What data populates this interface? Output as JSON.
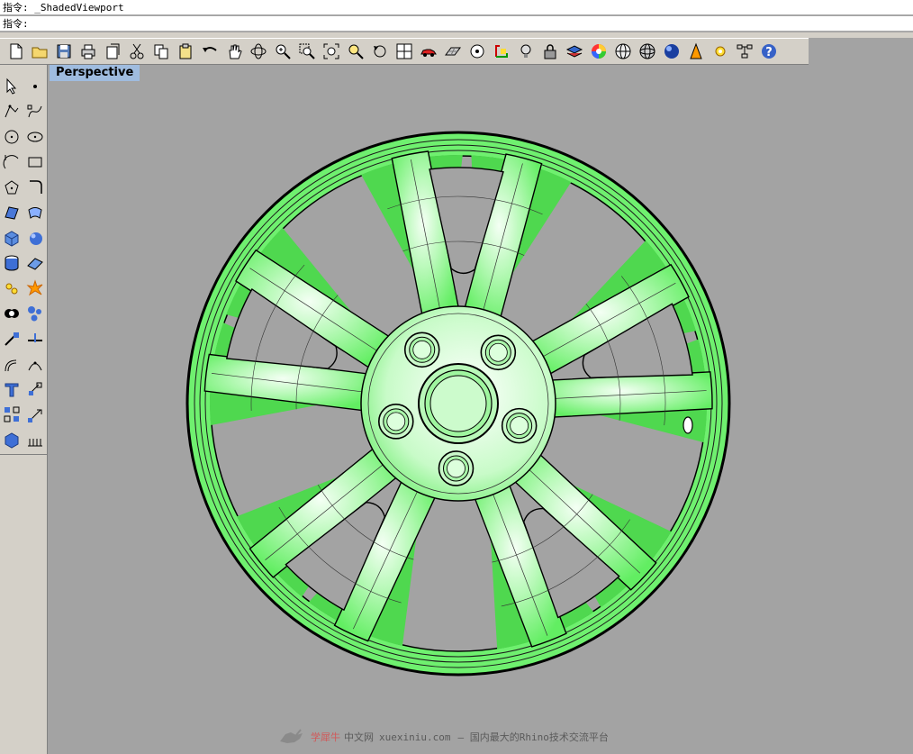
{
  "command": {
    "history_label": "指令:",
    "history_text": "_ShadedViewport",
    "prompt_label": "指令:",
    "input_value": ""
  },
  "toolbar_top": [
    {
      "icon": "new-file-icon"
    },
    {
      "icon": "open-folder-icon"
    },
    {
      "icon": "save-disk-icon"
    },
    {
      "icon": "print-icon"
    },
    {
      "icon": "import-icon"
    },
    {
      "icon": "cut-icon"
    },
    {
      "icon": "copy-icon"
    },
    {
      "icon": "paste-icon"
    },
    {
      "icon": "undo-icon"
    },
    {
      "icon": "pan-hand-icon"
    },
    {
      "icon": "rotate-view-icon"
    },
    {
      "icon": "zoom-dynamic-icon"
    },
    {
      "icon": "zoom-window-icon"
    },
    {
      "icon": "zoom-extents-icon"
    },
    {
      "icon": "zoom-selected-icon"
    },
    {
      "icon": "undo-view-icon"
    },
    {
      "icon": "four-viewports-icon"
    },
    {
      "icon": "car-icon"
    },
    {
      "icon": "grid-plane-icon"
    },
    {
      "icon": "osnap-icon"
    },
    {
      "icon": "gumball-icon"
    },
    {
      "icon": "light-bulb-icon"
    },
    {
      "icon": "lock-icon"
    },
    {
      "icon": "layer-icon"
    },
    {
      "icon": "color-wheel-icon"
    },
    {
      "icon": "wireframe-sphere-icon"
    },
    {
      "icon": "mesh-sphere-icon"
    },
    {
      "icon": "shaded-sphere-icon"
    },
    {
      "icon": "render-icon"
    },
    {
      "icon": "options-gear-icon"
    },
    {
      "icon": "tree-structure-icon"
    },
    {
      "icon": "help-icon"
    }
  ],
  "toolbar_left": [
    {
      "icon": "select-arrow-icon"
    },
    {
      "icon": "point-icon"
    },
    {
      "icon": "polyline-icon"
    },
    {
      "icon": "curve-icon"
    },
    {
      "icon": "circle-icon"
    },
    {
      "icon": "ellipse-icon"
    },
    {
      "icon": "arc-icon"
    },
    {
      "icon": "rectangle-icon"
    },
    {
      "icon": "polygon-icon"
    },
    {
      "icon": "fillet-icon"
    },
    {
      "icon": "surface-corner-icon"
    },
    {
      "icon": "surface-loft-icon"
    },
    {
      "icon": "box-solid-icon"
    },
    {
      "icon": "sphere-solid-icon"
    },
    {
      "icon": "cylinder-solid-icon"
    },
    {
      "icon": "plane-surface-icon"
    },
    {
      "icon": "explode-icon"
    },
    {
      "icon": "burst-icon"
    },
    {
      "icon": "boolean-union-icon"
    },
    {
      "icon": "boolean-split-icon"
    },
    {
      "icon": "trim-icon"
    },
    {
      "icon": "split-icon"
    },
    {
      "icon": "offset-icon"
    },
    {
      "icon": "blend-icon"
    },
    {
      "icon": "text-icon"
    },
    {
      "icon": "move-icon"
    },
    {
      "icon": "array-icon"
    },
    {
      "icon": "dimension-icon"
    },
    {
      "icon": "block-icon"
    },
    {
      "icon": "render-mesh-icon"
    }
  ],
  "viewport": {
    "title": "Perspective"
  },
  "watermark": {
    "brand": "学犀牛",
    "site": "中文网",
    "url": "xuexiniu.com",
    "tagline": "– 国内最大的Rhino技术交流平台"
  },
  "colors": {
    "viewport_bg": "#a3a3a3",
    "tab_bg": "#9fbcdf",
    "wheel_green": "#5fef5f",
    "wheel_light": "#dcffdc",
    "toolbar_bg": "#d4d0c8"
  }
}
